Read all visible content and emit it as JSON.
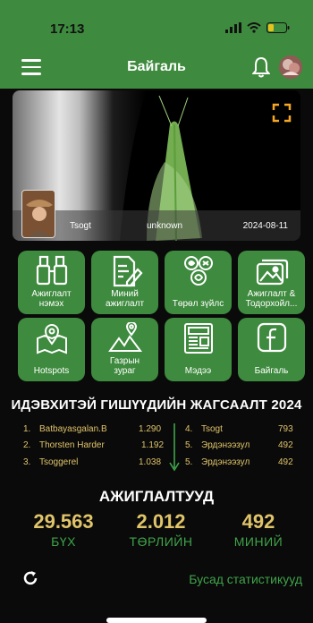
{
  "status": {
    "time": "17:13"
  },
  "appbar": {
    "title": "Байгаль"
  },
  "hero": {
    "user": "Tsogt",
    "species": "unknown",
    "date": "2024-08-11"
  },
  "tiles": [
    {
      "label": "Ажиглалт\nнэмэх",
      "icon": "binoculars-icon"
    },
    {
      "label": "Миний\nажиглалт",
      "icon": "edit-document-icon"
    },
    {
      "label": "Төрөл зүйлс",
      "icon": "species-icon"
    },
    {
      "label": "Ажиглалт &\nТодорхойл...",
      "icon": "photos-icon"
    },
    {
      "label": "Hotspots",
      "icon": "map-pin-icon"
    },
    {
      "label": "Газрын\nзураг",
      "icon": "terrain-map-icon"
    },
    {
      "label": "Мэдээ",
      "icon": "news-icon"
    },
    {
      "label": "Байгаль",
      "icon": "facebook-icon"
    }
  ],
  "leaderboard": {
    "title": "ИДЭВХИТЭЙ ГИШҮҮДИЙН ЖАГСААЛТ 2024",
    "left": [
      {
        "rank": "1.",
        "name": "Batbayasgalan.B",
        "count": "1.290"
      },
      {
        "rank": "2.",
        "name": "Thorsten Harder",
        "count": "1.192"
      },
      {
        "rank": "3.",
        "name": "Tsoggerel",
        "count": "1.038"
      }
    ],
    "right": [
      {
        "rank": "4.",
        "name": "Tsogt",
        "count": "793"
      },
      {
        "rank": "5.",
        "name": "Эрдэнээзул",
        "count": "492"
      },
      {
        "rank": "5.",
        "name": "Эрдэнээзул",
        "count": "492"
      }
    ]
  },
  "observations": {
    "title": "АЖИГЛАЛТУУД",
    "stats": [
      {
        "value": "29.563",
        "label": "БҮХ"
      },
      {
        "value": "2.012",
        "label": "ТӨРЛИЙН"
      },
      {
        "value": "492",
        "label": "МИНИЙ"
      }
    ]
  },
  "footer": {
    "more_stats": "Бусад статистикууд"
  },
  "colors": {
    "green": "#3e8a3e",
    "accent_text": "#3fa34a",
    "gold": "#e0c46a",
    "background": "#0a0a0a"
  }
}
